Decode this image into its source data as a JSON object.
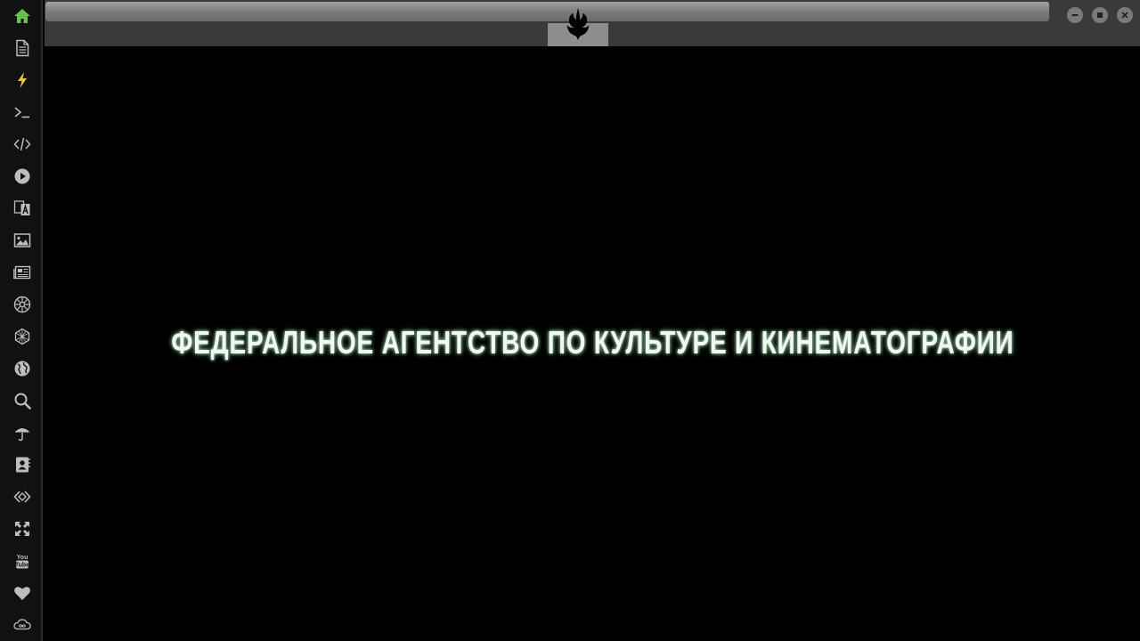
{
  "sidebar": {
    "items": [
      {
        "icon": "home-icon",
        "color": "#6bbf4e"
      },
      {
        "icon": "document-icon",
        "color": "#bdbdbd"
      },
      {
        "icon": "lightning-icon",
        "color": "#e8c34a"
      },
      {
        "icon": "terminal-icon",
        "color": "#bdbdbd"
      },
      {
        "icon": "code-icon",
        "color": "#bdbdbd"
      },
      {
        "icon": "play-icon",
        "color": "#bdbdbd"
      },
      {
        "icon": "translate-icon",
        "color": "#bdbdbd"
      },
      {
        "icon": "image-icon",
        "color": "#bdbdbd"
      },
      {
        "icon": "news-icon",
        "color": "#bdbdbd"
      },
      {
        "icon": "galactic-empire-icon",
        "color": "#bdbdbd"
      },
      {
        "icon": "hexagon-network-icon",
        "color": "#bdbdbd"
      },
      {
        "icon": "globe-icon",
        "color": "#bdbdbd"
      },
      {
        "icon": "search-icon",
        "color": "#bdbdbd"
      },
      {
        "icon": "umbrella-icon",
        "color": "#bdbdbd"
      },
      {
        "icon": "contacts-icon",
        "color": "#bdbdbd"
      },
      {
        "icon": "code-diamond-icon",
        "color": "#bdbdbd"
      },
      {
        "icon": "expand-icon",
        "color": "#bdbdbd"
      },
      {
        "icon": "youtube-icon",
        "color": "#bdbdbd"
      },
      {
        "icon": "heart-icon",
        "color": "#bdbdbd"
      },
      {
        "icon": "infinity-cloud-icon",
        "color": "#bdbdbd"
      }
    ]
  },
  "window": {
    "logo_icon": "rebel-alliance-icon",
    "minimize_icon": "minimize-icon",
    "maximize_icon": "maximize-icon",
    "close_icon": "close-icon"
  },
  "content": {
    "subtitle": "ФЕДЕРАЛЬНОЕ АГЕНТСТВО ПО КУЛЬТУРЕ И КИНЕМАТОГРАФИИ"
  },
  "colors": {
    "accent": "#6bbf4e",
    "sidebar_bg": "#111111",
    "topbar_bg": "#3a3a3a",
    "video_bg": "#000000",
    "subtitle_text": "#f2f7f2"
  }
}
